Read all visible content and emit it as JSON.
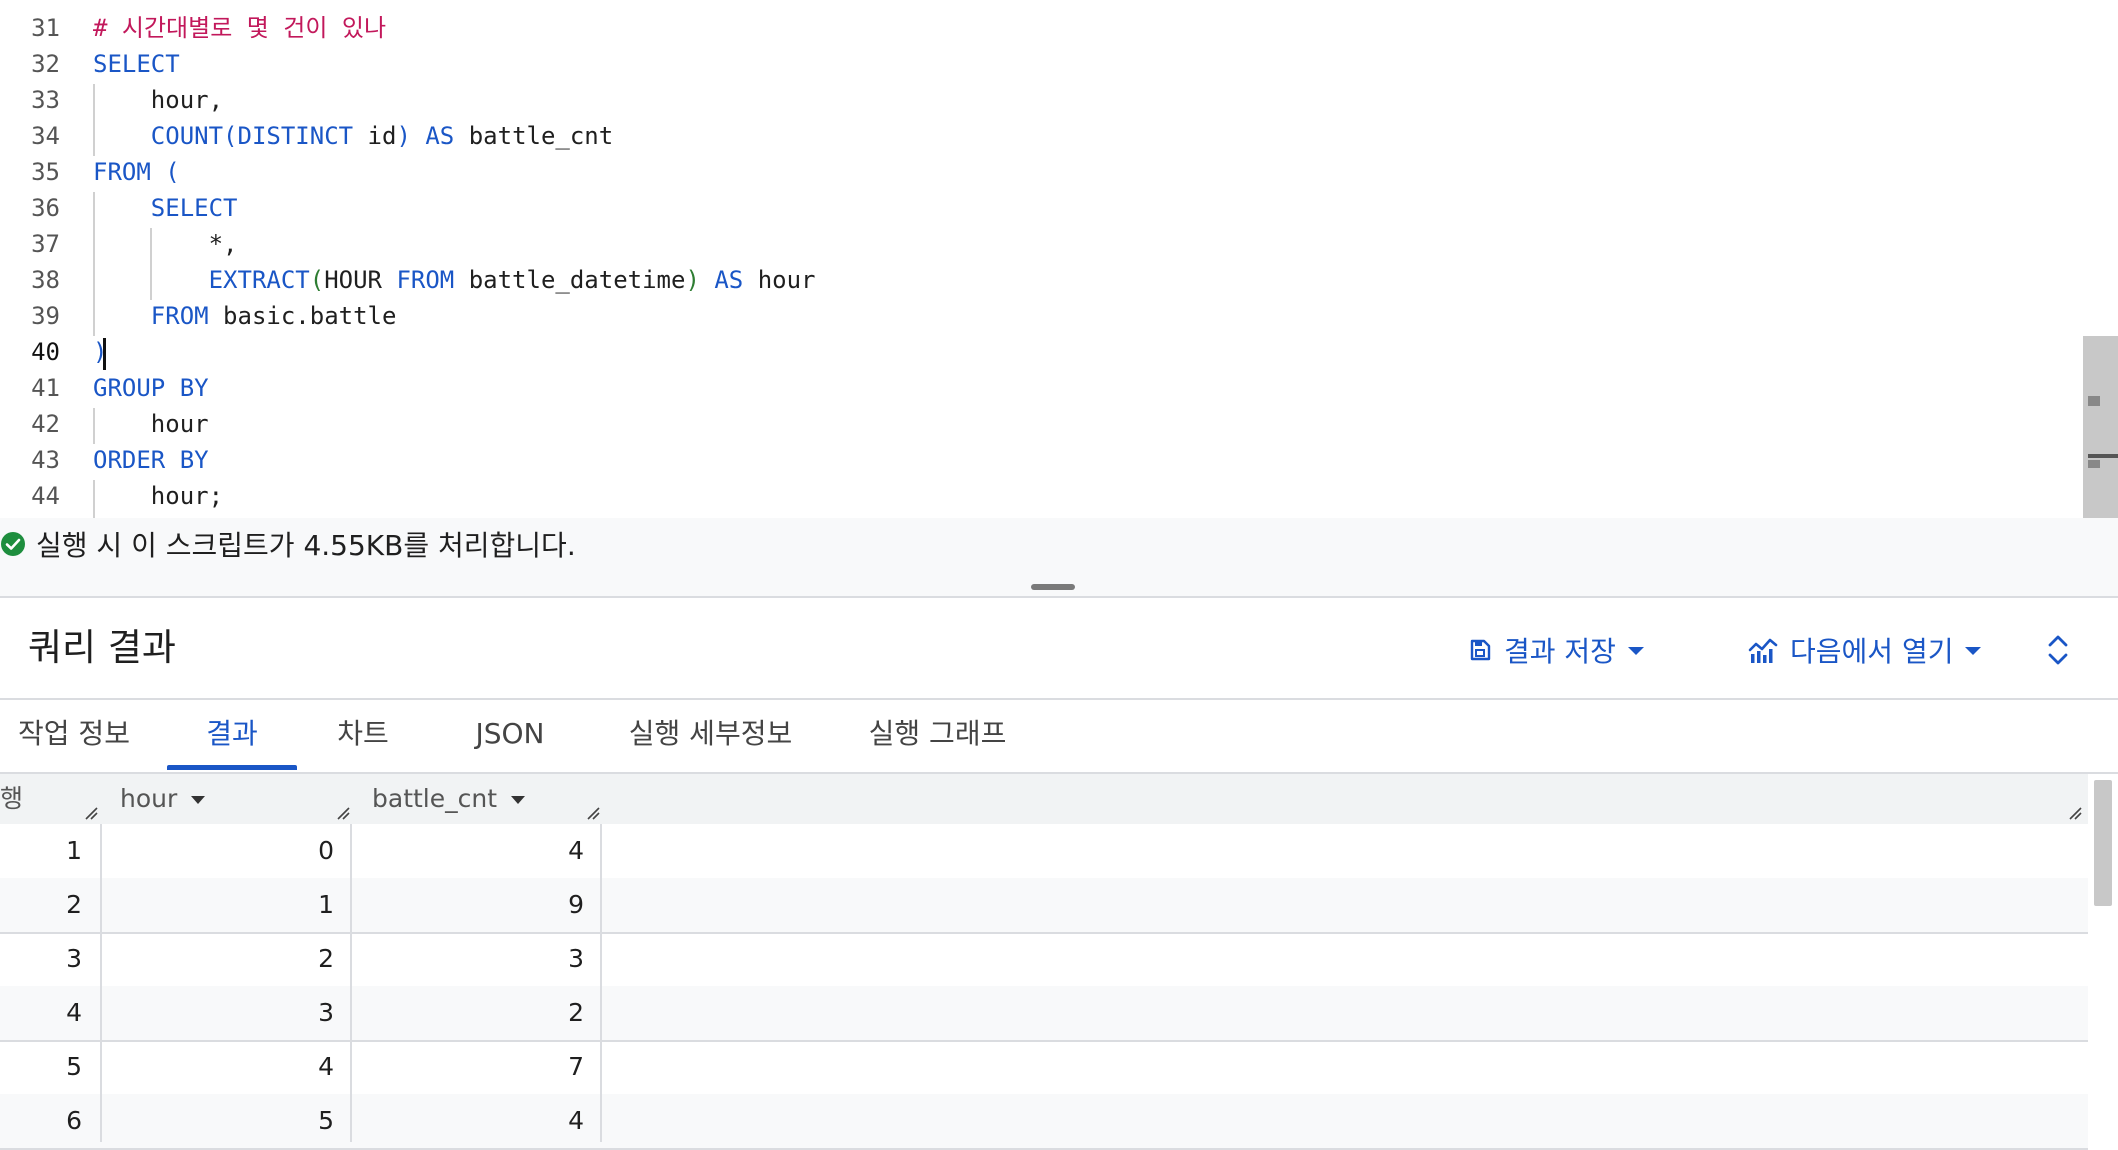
{
  "editor": {
    "lines": [
      {
        "num": "31",
        "tokens": [
          {
            "t": "# 시간대별로 몇 건이 있나",
            "c": "cm"
          }
        ]
      },
      {
        "num": "32",
        "tokens": [
          {
            "t": "SELECT",
            "c": "kw"
          }
        ]
      },
      {
        "num": "33",
        "tokens": [
          {
            "t": "    hour,",
            "c": "id"
          }
        ]
      },
      {
        "num": "34",
        "tokens": [
          {
            "t": "    ",
            "c": "id"
          },
          {
            "t": "COUNT",
            "c": "kw"
          },
          {
            "t": "(",
            "c": "kw"
          },
          {
            "t": "DISTINCT",
            "c": "kw"
          },
          {
            "t": " id",
            "c": "id"
          },
          {
            "t": ")",
            "c": "kw"
          },
          {
            "t": " AS",
            "c": "kw"
          },
          {
            "t": " battle_cnt",
            "c": "id"
          }
        ]
      },
      {
        "num": "35",
        "tokens": [
          {
            "t": "FROM",
            "c": "kw"
          },
          {
            "t": " (",
            "c": "kw"
          }
        ]
      },
      {
        "num": "36",
        "tokens": [
          {
            "t": "    ",
            "c": "id"
          },
          {
            "t": "SELECT",
            "c": "kw"
          }
        ]
      },
      {
        "num": "37",
        "tokens": [
          {
            "t": "        *,",
            "c": "id"
          }
        ]
      },
      {
        "num": "38",
        "tokens": [
          {
            "t": "        ",
            "c": "id"
          },
          {
            "t": "EXTRACT",
            "c": "kw"
          },
          {
            "t": "(",
            "c": "pn"
          },
          {
            "t": "HOUR",
            "c": "id"
          },
          {
            "t": " FROM",
            "c": "kw"
          },
          {
            "t": " battle_datetime",
            "c": "id"
          },
          {
            "t": ")",
            "c": "pn"
          },
          {
            "t": " AS",
            "c": "kw"
          },
          {
            "t": " hour",
            "c": "id"
          }
        ]
      },
      {
        "num": "39",
        "tokens": [
          {
            "t": "    ",
            "c": "id"
          },
          {
            "t": "FROM",
            "c": "kw"
          },
          {
            "t": " basic.battle",
            "c": "id"
          }
        ]
      },
      {
        "num": "40",
        "tokens": [
          {
            "t": ")",
            "c": "kw"
          }
        ]
      },
      {
        "num": "41",
        "tokens": [
          {
            "t": "GROUP BY",
            "c": "kw"
          }
        ]
      },
      {
        "num": "42",
        "tokens": [
          {
            "t": "    hour",
            "c": "id"
          }
        ]
      },
      {
        "num": "43",
        "tokens": [
          {
            "t": "ORDER BY",
            "c": "kw"
          }
        ]
      },
      {
        "num": "44",
        "tokens": [
          {
            "t": "    hour;",
            "c": "id"
          }
        ]
      }
    ],
    "active_line": "40"
  },
  "status": {
    "text": "실행 시 이 스크립트가 4.55KB를 처리합니다."
  },
  "results": {
    "title": "쿼리 결과",
    "save_label": "결과 저장",
    "open_label": "다음에서 열기"
  },
  "tabs": [
    "작업 정보",
    "결과",
    "차트",
    "JSON",
    "실행 세부정보",
    "실행 그래프"
  ],
  "active_tab": "결과",
  "table": {
    "row_header": "행",
    "columns": [
      "hour",
      "battle_cnt"
    ],
    "rows": [
      [
        "1",
        "0",
        "4"
      ],
      [
        "2",
        "1",
        "9"
      ],
      [
        "3",
        "2",
        "3"
      ],
      [
        "4",
        "3",
        "2"
      ],
      [
        "5",
        "4",
        "7"
      ],
      [
        "6",
        "5",
        "4"
      ]
    ]
  },
  "colors": {
    "accent": "#1a56c6",
    "comment": "#c2185b",
    "paren": "#2e7d32",
    "success": "#1e8e3e"
  }
}
